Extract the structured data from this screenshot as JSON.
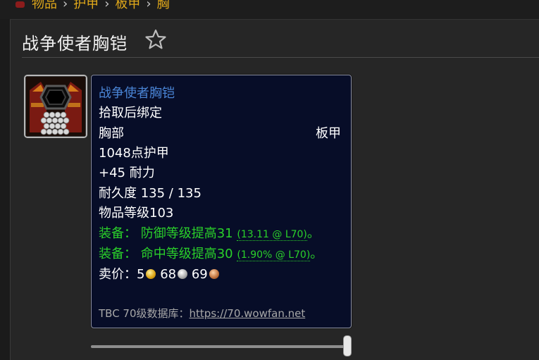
{
  "breadcrumb": {
    "items": [
      "物品",
      "护甲",
      "板甲",
      "胸"
    ],
    "separator": "›"
  },
  "page": {
    "title": "战争使者胸铠"
  },
  "tooltip": {
    "name": "战争使者胸铠",
    "bind": "拾取后绑定",
    "slot": "胸部",
    "armor_type": "板甲",
    "armor": "1048点护甲",
    "stamina": "+45 耐力",
    "durability": "耐久度 135 / 135",
    "item_level": "物品等级103",
    "equip1_text": "装备： 防御等级提高31",
    "equip1_detail": "(13.11 @ L70)",
    "equip1_end": "。",
    "equip2_text": "装备： 命中等级提高30",
    "equip2_detail": "(1.90% @ L70)",
    "equip2_end": "。",
    "sell_label": "卖价：",
    "sell_gold": "5",
    "sell_silver": "68",
    "sell_copper": "69",
    "source_label": "TBC 70级数据库：",
    "source_link": "https://70.wowfan.net"
  },
  "colors": {
    "item_name": "#4a85d6",
    "equip_green": "#2ad02a",
    "breadcrumb": "#e0a81a",
    "tooltip_bg": "#070d28"
  },
  "icons": {
    "favorite": "star-outline-icon",
    "item": "plate-chest-armor-icon"
  },
  "slider": {
    "value_percent": 100
  }
}
